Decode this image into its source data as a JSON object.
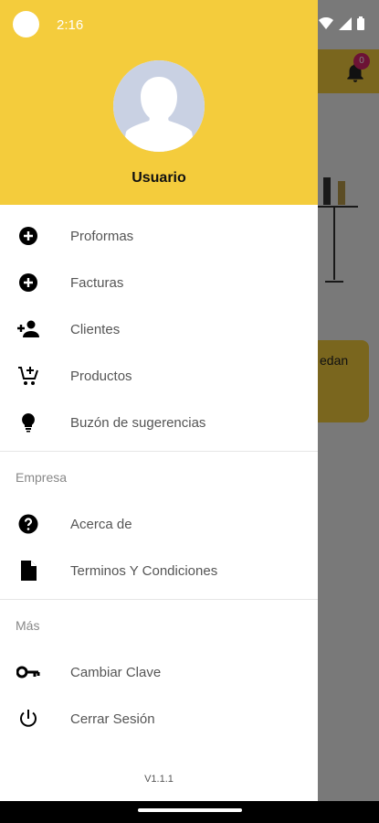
{
  "status": {
    "time": "2:16"
  },
  "background": {
    "badge_count": "0",
    "card_text": "edan"
  },
  "header": {
    "user_name": "Usuario"
  },
  "menu": {
    "items": [
      {
        "label": "Proformas",
        "icon": "add-circle-icon"
      },
      {
        "label": "Facturas",
        "icon": "add-circle-icon"
      },
      {
        "label": "Clientes",
        "icon": "person-add-icon"
      },
      {
        "label": "Productos",
        "icon": "add-cart-icon"
      },
      {
        "label": "Buzón de sugerencias",
        "icon": "lightbulb-icon"
      }
    ]
  },
  "empresa": {
    "title": "Empresa",
    "items": [
      {
        "label": "Acerca de",
        "icon": "help-circle-icon"
      },
      {
        "label": "Terminos Y Condiciones",
        "icon": "document-icon"
      }
    ]
  },
  "mas": {
    "title": "Más",
    "items": [
      {
        "label": "Cambiar Clave",
        "icon": "key-icon"
      },
      {
        "label": "Cerrar Sesión",
        "icon": "power-icon"
      }
    ]
  },
  "footer": {
    "version": "V1.1.1"
  },
  "colors": {
    "accent": "#f4cc3c",
    "badge": "#d8246a"
  }
}
